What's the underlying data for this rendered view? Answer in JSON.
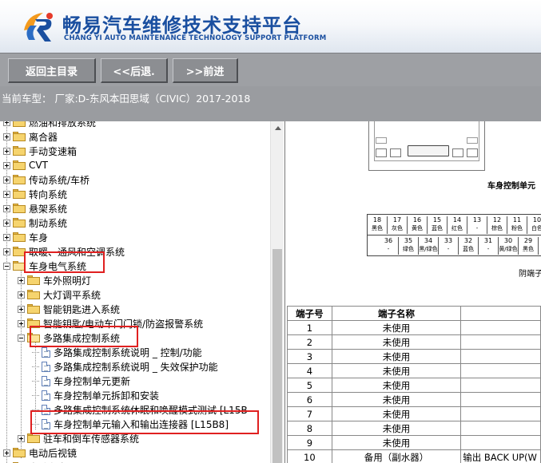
{
  "header": {
    "title": "畅易汽车维修技术支持平台",
    "subtitle": "CHANG YI AUTO MAINTENANCE TECHNOLOGY SUPPORT PLATFORM",
    "brand_color": "#1a4fa0"
  },
  "toolbar": {
    "home_label": "返回主目录",
    "back_label": "<<后退.",
    "forward_label": ">>前进"
  },
  "vehicle": {
    "text": "当前车型： 厂家:D-东风本田思域（CIVIC）2017-2018"
  },
  "tree": {
    "items": [
      {
        "label": "燃油和排放系统",
        "expander": "plus",
        "icon": "folder-icon"
      },
      {
        "label": "离合器",
        "expander": "plus",
        "icon": "folder-icon"
      },
      {
        "label": "手动变速箱",
        "expander": "plus",
        "icon": "folder-icon"
      },
      {
        "label": "CVT",
        "expander": "plus",
        "icon": "folder-icon"
      },
      {
        "label": "传动系统/车桥",
        "expander": "plus",
        "icon": "folder-icon"
      },
      {
        "label": "转向系统",
        "expander": "plus",
        "icon": "folder-icon"
      },
      {
        "label": "悬架系统",
        "expander": "plus",
        "icon": "folder-icon"
      },
      {
        "label": "制动系统",
        "expander": "plus",
        "icon": "folder-icon"
      },
      {
        "label": "车身",
        "expander": "plus",
        "icon": "folder-icon"
      },
      {
        "label": "取暖、通风和空调系统",
        "expander": "plus",
        "icon": "folder-icon"
      },
      {
        "label": "车身电气系统",
        "expander": "minus",
        "icon": "folder-open-icon"
      },
      {
        "label": "车外照明灯",
        "expander": "plus",
        "icon": "folder-icon"
      },
      {
        "label": "大灯调平系统",
        "expander": "plus",
        "icon": "folder-icon"
      },
      {
        "label": "智能钥匙进入系统",
        "expander": "plus",
        "icon": "folder-icon"
      },
      {
        "label": "智能钥匙/电动车门门锁/防盗报警系统",
        "expander": "plus",
        "icon": "folder-icon"
      },
      {
        "label": "多路集成控制系统",
        "expander": "minus",
        "icon": "folder-open-icon"
      },
      {
        "label": "多路集成控制系统说明 _ 控制/功能",
        "expander": "none",
        "icon": "document-icon"
      },
      {
        "label": "多路集成控制系统说明 _ 失效保护功能",
        "expander": "none",
        "icon": "document-icon"
      },
      {
        "label": "车身控制单元更新",
        "expander": "none",
        "icon": "document-icon"
      },
      {
        "label": "车身控制单元拆卸和安装",
        "expander": "none",
        "icon": "document-icon"
      },
      {
        "label": "多路集成控制系统休眠和唤醒模式测试 [L15B",
        "expander": "none",
        "icon": "document-icon"
      },
      {
        "label": "车身控制单元输入和输出连接器 [L15B8]",
        "expander": "none",
        "icon": "document-icon"
      },
      {
        "label": "驻车和倒车传感器系统",
        "expander": "plus",
        "icon": "folder-icon"
      },
      {
        "label": "电动后视镜",
        "expander": "plus",
        "icon": "folder-icon"
      },
      {
        "label": "电动车窗",
        "expander": "plus",
        "icon": "folder-icon"
      }
    ]
  },
  "diagram": {
    "caption_top": "车身控制单元",
    "caption_side": "阴端子",
    "row1": [
      {
        "n": "18",
        "c": "黑色"
      },
      {
        "n": "17",
        "c": "灰色"
      },
      {
        "n": "16",
        "c": "黄色"
      },
      {
        "n": "15",
        "c": "蓝色"
      },
      {
        "n": "14",
        "c": "红色"
      },
      {
        "n": "13",
        "c": "-"
      },
      {
        "n": "12",
        "c": "棕色"
      },
      {
        "n": "11",
        "c": "粉色"
      },
      {
        "n": "10",
        "c": "白色"
      }
    ],
    "row2": [
      {
        "n": "36",
        "c": "-"
      },
      {
        "n": "35",
        "c": "绿色"
      },
      {
        "n": "34",
        "c": "黑/绿色"
      },
      {
        "n": "33",
        "c": "-"
      },
      {
        "n": "32",
        "c": "蓝色"
      },
      {
        "n": "31",
        "c": "-"
      },
      {
        "n": "30",
        "c": "黄/绿色"
      },
      {
        "n": "29",
        "c": "黑色"
      }
    ]
  },
  "pin_table": {
    "headers": [
      "端子号",
      "端子名称",
      ""
    ],
    "rows": [
      [
        "1",
        "未使用",
        ""
      ],
      [
        "2",
        "未使用",
        ""
      ],
      [
        "3",
        "未使用",
        ""
      ],
      [
        "4",
        "未使用",
        ""
      ],
      [
        "5",
        "未使用",
        ""
      ],
      [
        "6",
        "未使用",
        ""
      ],
      [
        "7",
        "未使用",
        ""
      ],
      [
        "8",
        "未使用",
        ""
      ],
      [
        "9",
        "未使用",
        ""
      ],
      [
        "10",
        "备用（副水器）",
        "输出 BACK UP(W"
      ]
    ]
  }
}
